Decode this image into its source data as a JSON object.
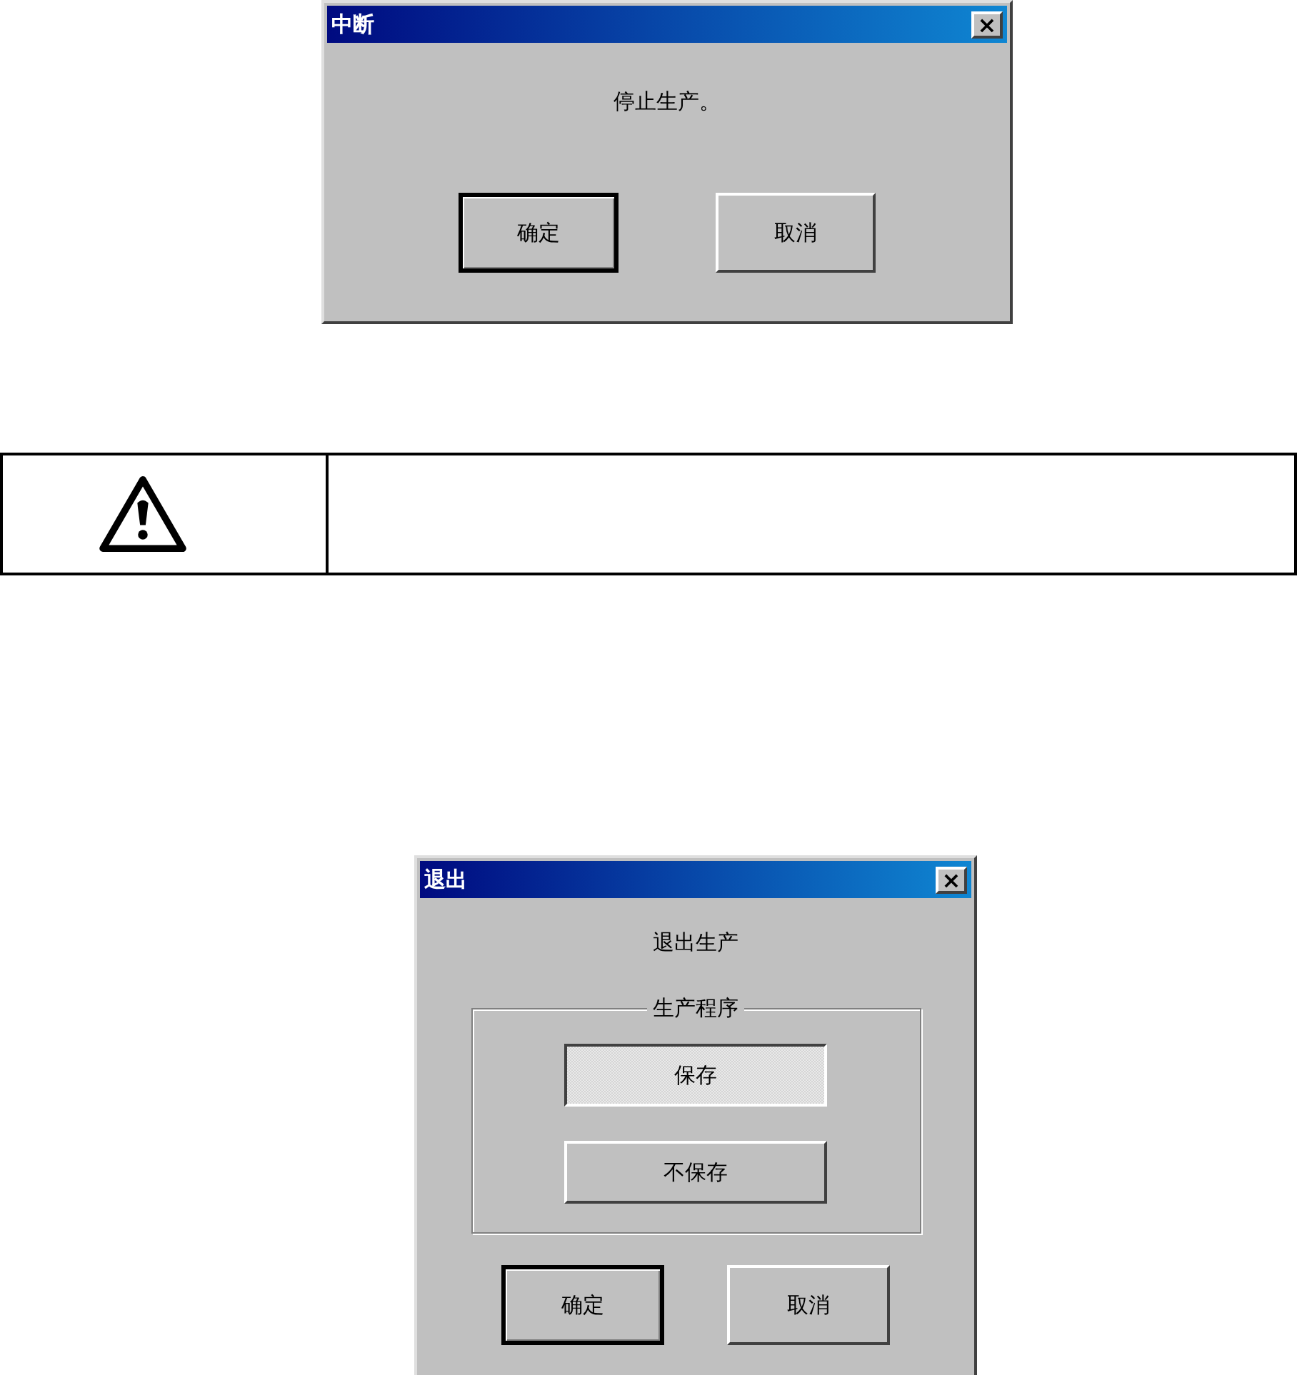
{
  "dialogs": [
    {
      "title": "中断",
      "close": "×",
      "message": "停止生产。",
      "buttons": [
        {
          "label": "确定",
          "default": true
        },
        {
          "label": "取消",
          "default": false
        }
      ]
    },
    {
      "title": "退出",
      "close": "×",
      "message": "退出生产",
      "group": {
        "legend": "生产程序",
        "options": [
          {
            "label": "保存",
            "selected": true
          },
          {
            "label": "不保存",
            "selected": false
          }
        ]
      },
      "buttons": [
        {
          "label": "确定",
          "default": true
        },
        {
          "label": "取消",
          "default": false
        }
      ]
    }
  ],
  "notice": {
    "kind": "warning"
  }
}
